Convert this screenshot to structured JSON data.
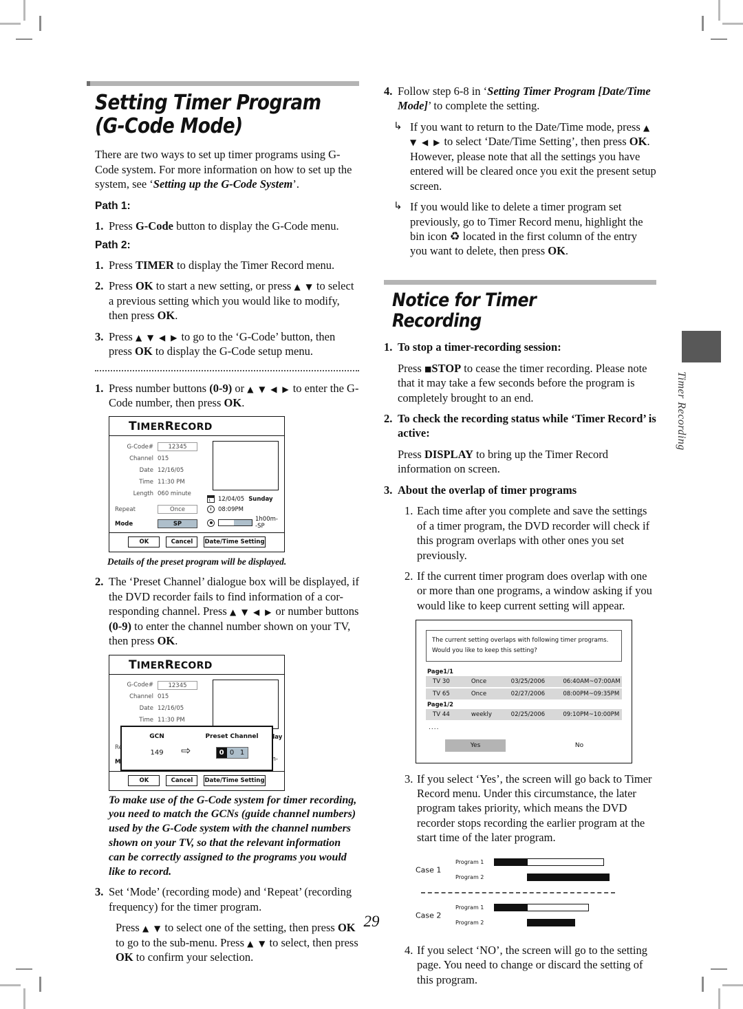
{
  "page": {
    "number": "29",
    "side_tab_label": "Timer Recording"
  },
  "left": {
    "heading_line1": "Setting Timer Program",
    "heading_line2": "(G-Code Mode)",
    "intro": "There are two ways to set up timer programs using G-Code system. For more information on how to set up the system, see ‘",
    "intro_italic": "Setting up the G-Code System",
    "intro_end": "’.",
    "path1_label": "Path 1:",
    "path1_step1_num": "1.",
    "path1_step1_a": "Press ",
    "path1_step1_b": "G-Code",
    "path1_step1_c": " button to display the G-Code menu.",
    "path2_label": "Path 2:",
    "p2_s1_num": "1.",
    "p2_s1_a": "Press ",
    "p2_s1_b": "TIMER",
    "p2_s1_c": " to display the Timer Record menu.",
    "p2_s2_num": "2.",
    "p2_s2_a": "Press ",
    "p2_s2_b": "OK",
    "p2_s2_c": " to start a new setting, or press ",
    "p2_s2_arrows": "▲ ▼",
    "p2_s2_d": " to select a previous setting which you would like to modify, then press ",
    "p2_s2_e": "OK",
    "p2_s2_f": ".",
    "p2_s3_num": "3.",
    "p2_s3_a": "Press ",
    "p2_s3_arrows": "▲ ▼ ◀ ▶",
    "p2_s3_b": " to go to the ‘G-Code’ button, then press ",
    "p2_s3_c": "OK",
    "p2_s3_d": " to display the G-Code setup menu.",
    "d1_num": "1.",
    "d1_a": "Press number buttons ",
    "d1_b": "(0-9)",
    "d1_c": " or ",
    "d1_arrows": "▲ ▼ ◀ ▶",
    "d1_d": " to enter the G-Code number, then press ",
    "d1_e": "OK",
    "d1_f": ".",
    "caption1": "Details of the preset program will be displayed.",
    "d2_num": "2.",
    "d2_a": "The ‘Preset Channel’ dialogue box will be displayed, if the DVD recorder fails to find information of a cor-responding channel. Press ",
    "d2_arrows": "▲ ▼ ◀ ▶",
    "d2_b": " or number buttons ",
    "d2_c": "(0-9)",
    "d2_d": " to enter the channel number shown on your TV, then press ",
    "d2_e": "OK",
    "d2_f": ".",
    "note_italic": "To make use of the G-Code system for timer recording, you need to match the GCNs (guide channel numbers) used by the G-Code system with the channel numbers shown on your TV, so that the relevant information can be correctly assigned to the programs you would like to record.",
    "d3_num": "3.",
    "d3_a": "Set ‘Mode’ (recording mode) and ‘Repeat’ (recording frequency) for the timer program.",
    "d3_p_a": "Press ",
    "d3_p_arrows": "▲ ▼",
    "d3_p_b": " to select one of the setting, then press ",
    "d3_p_c": "OK",
    "d3_p_d": " to go to the sub-menu. Press ",
    "d3_p_arrows2": "▲ ▼",
    "d3_p_e": " to select, then press ",
    "d3_p_f": "OK",
    "d3_p_g": " to confirm your selection."
  },
  "timer_record_screen": {
    "title": "TIMER RECORD",
    "title_t": "T",
    "title_imer": "IMER",
    "title_r": "R",
    "title_ecord": "ECORD",
    "fields": [
      {
        "label": "G-Code#",
        "value": "12345",
        "boxed": true
      },
      {
        "label": "Channel",
        "value": "015"
      },
      {
        "label": "Date",
        "value": "12/16/05"
      },
      {
        "label": "Time",
        "value": "11:30 PM"
      },
      {
        "label": "Length",
        "value": "060 minute"
      }
    ],
    "repeat_label": "Repeat",
    "repeat_value": "Once",
    "mode_label": "Mode",
    "mode_value": "SP",
    "info_date": "12/04/05",
    "info_day": "Sunday",
    "info_time": "08:09PM",
    "info_rec": "1h00m--SP",
    "buttons": {
      "ok": "OK",
      "cancel": "Cancel",
      "datetime": "Date/Time Setting"
    }
  },
  "gcn_dialog": {
    "gcn_label": "GCN",
    "preset_label": "Preset Channel",
    "gcn_value": "149",
    "digits": [
      "0",
      "0",
      "1"
    ]
  },
  "right": {
    "s4_num": "4.",
    "s4_a": "Follow step 6-8 in ‘",
    "s4_italic": "Setting Timer Program [Date/Time Mode]",
    "s4_b": "’ to complete the setting.",
    "hook1_a": "If you want to return to the Date/Time mode, press ",
    "hook1_arrows": "▲ ▼ ◀ ▶",
    "hook1_b": " to select ‘Date/Time Setting’, then press ",
    "hook1_c": "OK",
    "hook1_d": ". However, please note that all the settings you have entered will be cleared once you exit the present setup screen.",
    "hook2_a": "If you would like to delete a timer program set previously, go to Timer Record menu, highlight the bin icon ",
    "hook2_icon": "♻",
    "hook2_b": " located in the first column of the entry you want to delete, then press ",
    "hook2_c": "OK",
    "hook2_d": ".",
    "notice_title": "Notice for Timer Recording",
    "n1_num": "1.",
    "n1_head": "To stop a timer-recording session:",
    "n1_a": "Press ",
    "n1_sq": "■",
    "n1_b": "STOP",
    "n1_c": " to cease the timer recording. Please note that it may take a few seconds before the program is completely brought to an end.",
    "n2_num": "2.",
    "n2_head": "To check the recording status while ‘Timer Record’ is active:",
    "n2_a": "Press ",
    "n2_b": "DISPLAY",
    "n2_c": " to bring up the Timer Record information on screen.",
    "n3_num": "3.",
    "n3_head": "About the overlap of timer programs",
    "n3_1_num": "1.",
    "n3_1": "Each time after you complete and save the settings of a timer program, the DVD recorder will check if this program overlaps with other ones you set previously.",
    "n3_2_num": "2.",
    "n3_2": "If the current timer program does overlap with one or more than one programs, a window asking if you would like to keep current setting will appear.",
    "n3_3_num": "3.",
    "n3_3": "If you select ‘Yes’, the screen will go back to Timer Record menu. Under this circumstance, the later program takes priority, which means the DVD recorder stops recording the earlier program at the start time of the later program.",
    "n3_4_num": "4.",
    "n3_4": "If you select ‘NO’, the screen will go to the setting page. You need to change or discard the setting of this program."
  },
  "overlap_dialog": {
    "message_line1": "The current setting overlaps with following timer programs.",
    "message_line2": "Would you like to keep this setting?",
    "page_label_1": "Page1/1",
    "page_label_2": "Page1/2",
    "rows_page1": [
      {
        "channel": "TV 30",
        "repeat": "Once",
        "date": "03/25/2006",
        "time": "06:40AM~07:00AM"
      },
      {
        "channel": "TV 65",
        "repeat": "Once",
        "date": "02/27/2006",
        "time": "08:00PM~09:35PM"
      }
    ],
    "rows_page2": [
      {
        "channel": "TV 44",
        "repeat": "weekly",
        "date": "02/25/2006",
        "time": "09:10PM~10:00PM"
      }
    ],
    "dots": "....",
    "yes_label": "Yes",
    "no_label": "No"
  },
  "case_diagram": {
    "case1_label": "Case 1",
    "case2_label": "Case 2",
    "program1_label": "Program 1",
    "program2_label": "Program 2"
  }
}
